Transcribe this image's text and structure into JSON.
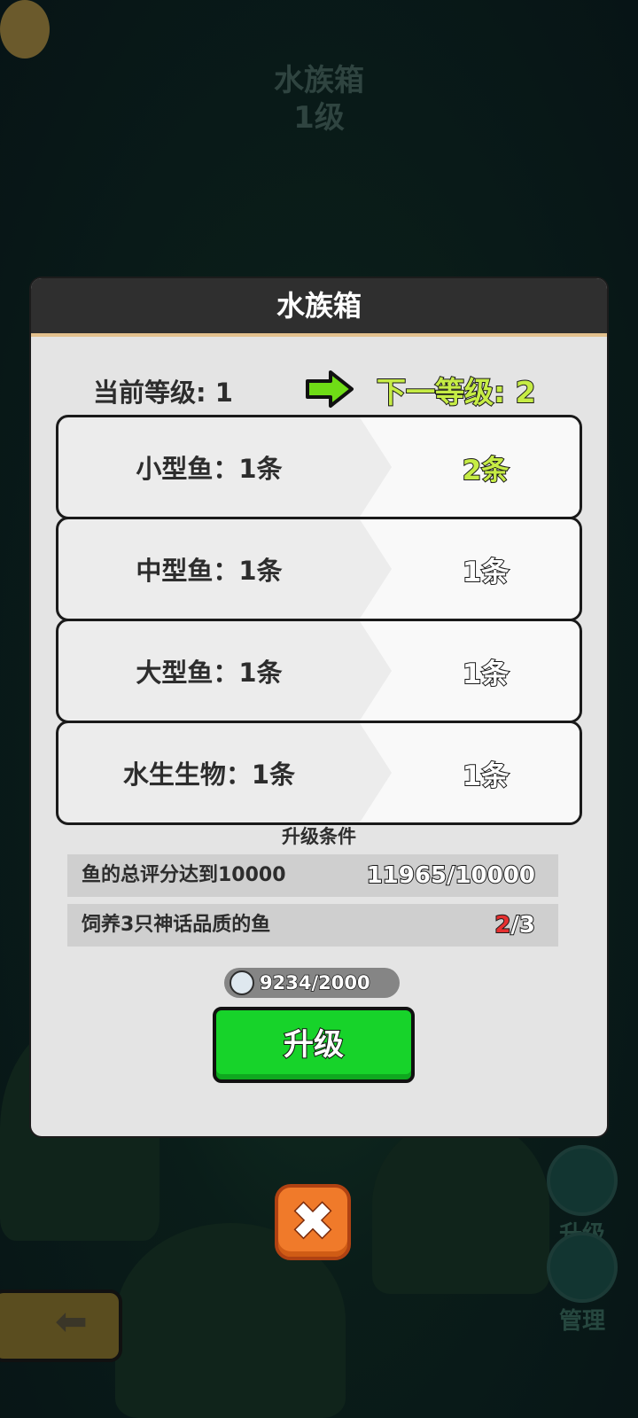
{
  "background": {
    "title_line1": "水族箱",
    "title_line2": "1级",
    "side_upgrade_label": "升级",
    "side_manage_label": "管理"
  },
  "dialog": {
    "title": "水族箱",
    "current_level": "当前等级: 1",
    "next_level": "下一等级: 2",
    "stats": [
      {
        "label": "小型鱼：1条",
        "next": "2条",
        "highlight": true
      },
      {
        "label": "中型鱼：1条",
        "next": "1条",
        "highlight": false
      },
      {
        "label": "大型鱼：1条",
        "next": "1条",
        "highlight": false
      },
      {
        "label": "水生生物：1条",
        "next": "1条",
        "highlight": false
      }
    ],
    "requirements_title": "升级条件",
    "requirements": [
      {
        "label": "鱼的总评分达到10000",
        "progress": "11965/10000"
      },
      {
        "label": "饲养3只神话品质的鱼",
        "progress_current": "2",
        "progress_total": "/3"
      }
    ],
    "cost": "9234/2000",
    "upgrade_button": "升级"
  },
  "colors": {
    "accent_green": "#17d32a",
    "highlight_yellow": "#c6ec45",
    "warning_red": "#e53030",
    "close_orange": "#f07a2a"
  },
  "icons": [
    "arrow-right-icon",
    "shark-coin-icon",
    "close-icon",
    "back-arrow-icon",
    "fish-icon"
  ]
}
